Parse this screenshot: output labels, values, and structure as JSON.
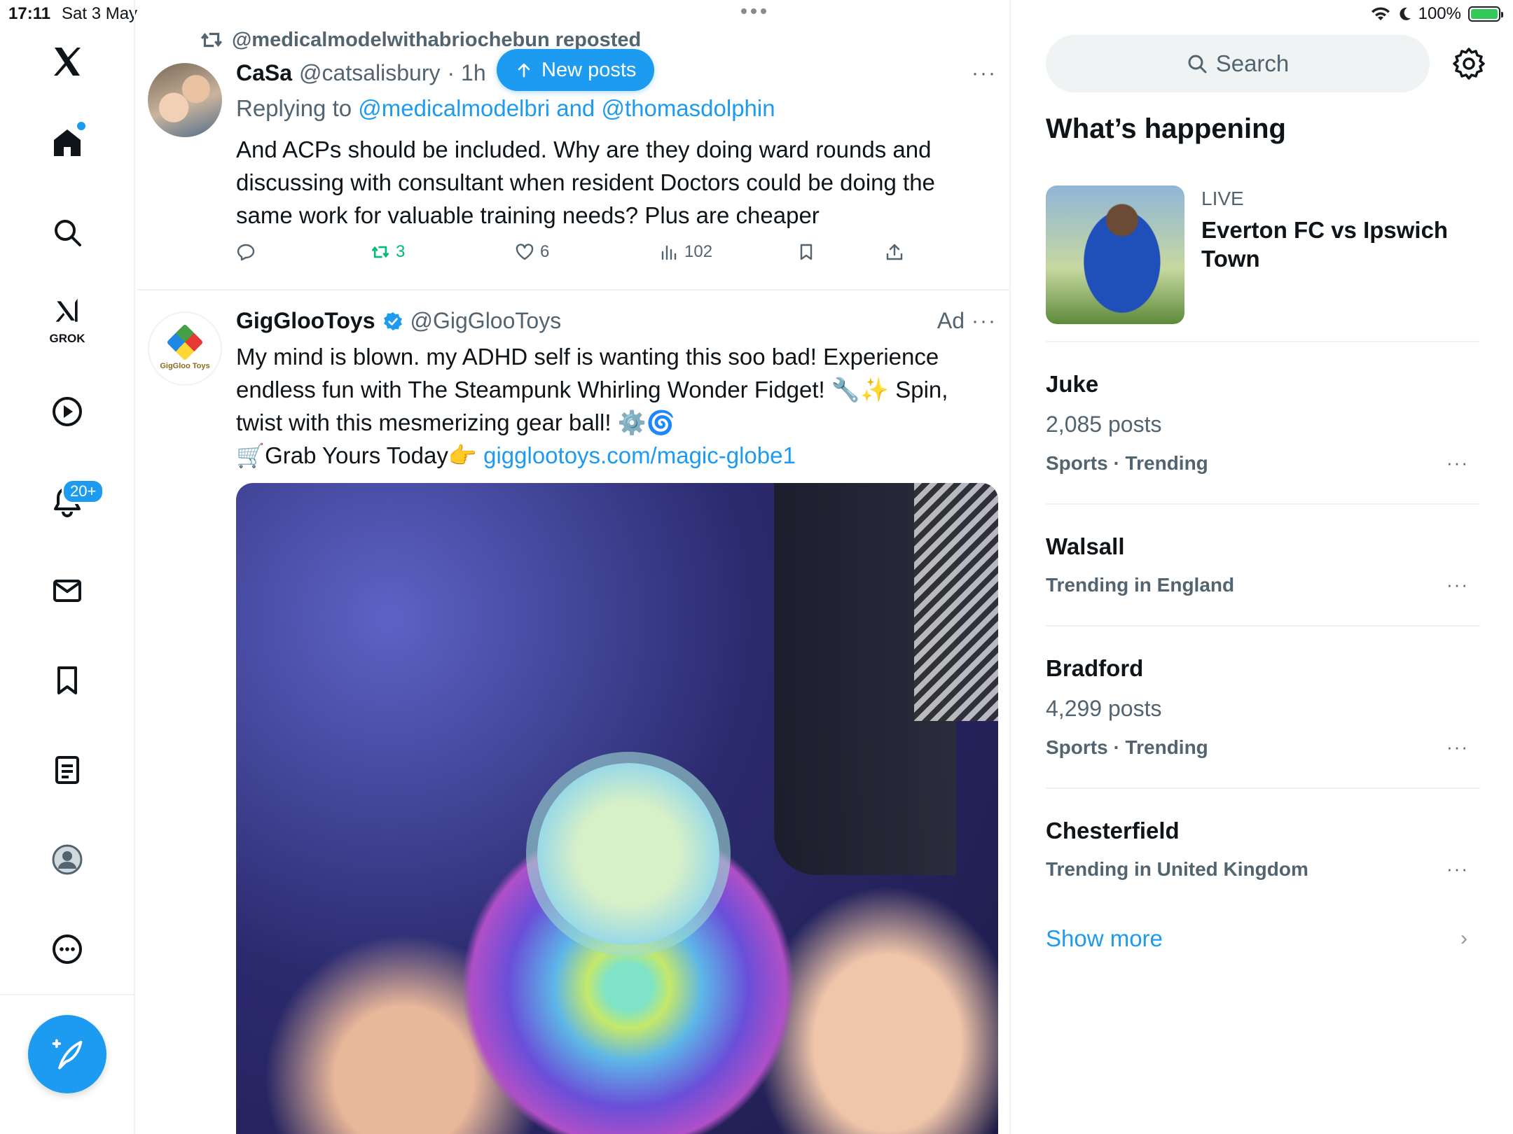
{
  "status_bar": {
    "time": "17:11",
    "date": "Sat 3 May",
    "battery": "100%",
    "battery_level": 1.0
  },
  "nav": {
    "items": [
      {
        "name": "x-logo",
        "icon": "x-logo-icon"
      },
      {
        "name": "home",
        "icon": "home-icon"
      },
      {
        "name": "explore",
        "icon": "search-icon"
      },
      {
        "name": "grok",
        "icon": "grok-icon",
        "label": "GROK"
      },
      {
        "name": "video",
        "icon": "play-icon"
      },
      {
        "name": "notifications",
        "icon": "bell-icon",
        "badge": "20+"
      },
      {
        "name": "messages",
        "icon": "mail-icon"
      },
      {
        "name": "bookmarks",
        "icon": "bookmark-icon"
      },
      {
        "name": "lists",
        "icon": "list-icon"
      },
      {
        "name": "profile",
        "icon": "profile-icon"
      },
      {
        "name": "more",
        "icon": "more-circle-icon"
      }
    ],
    "compose_icon": "compose-icon"
  },
  "feed": {
    "new_posts_label": "New posts",
    "tweet1": {
      "repost_line": "@medicalmodelwithabriochebun reposted",
      "name": "CaSa",
      "handle": "@catsalisbury",
      "time": "· 1h",
      "replying_prefix": "Replying to",
      "replying_to": "@medicalmodelbri and @thomasdolphin",
      "text": "And ACPs should be included. Why are they doing ward rounds and discussing with consultant when resident Doctors could be doing the same work for valuable training needs? Plus are cheaper",
      "retweets": "3",
      "likes": "6",
      "views": "102"
    },
    "tweet2": {
      "name": "GigGlooToys",
      "handle": "@GigGlooToys",
      "ad_label": "Ad",
      "avatar_text": "GigGloo Toys",
      "text_line1": "My mind is blown. my ADHD self is wanting this soo bad! Experience endless fun with The Steampunk Whirling Wonder Fidget! 🔧✨ Spin, twist with this mesmerizing gear ball! ⚙️🌀",
      "text_line2": "🛒Grab Yours Today👉",
      "link": "gigglootoys.com/magic-globe1"
    }
  },
  "sidebar": {
    "search_placeholder": "Search",
    "section_title": "What’s happening",
    "live": {
      "label": "LIVE",
      "title": "Everton FC vs Ipswich Town"
    },
    "trends": [
      {
        "name": "Juke",
        "count": "2,085 posts",
        "meta": "Sports · Trending"
      },
      {
        "name": "Walsall",
        "count": "",
        "meta": "Trending in England"
      },
      {
        "name": "Bradford",
        "count": "4,299 posts",
        "meta": "Sports · Trending"
      },
      {
        "name": "Chesterfield",
        "count": "",
        "meta": "Trending in United Kingdom"
      }
    ],
    "show_more": "Show more"
  },
  "colors": {
    "accent": "#1d9bf0",
    "text": "#0f1419",
    "secondary": "#536471",
    "retweet_green": "#00ba7c",
    "divider": "#eff3f4"
  }
}
